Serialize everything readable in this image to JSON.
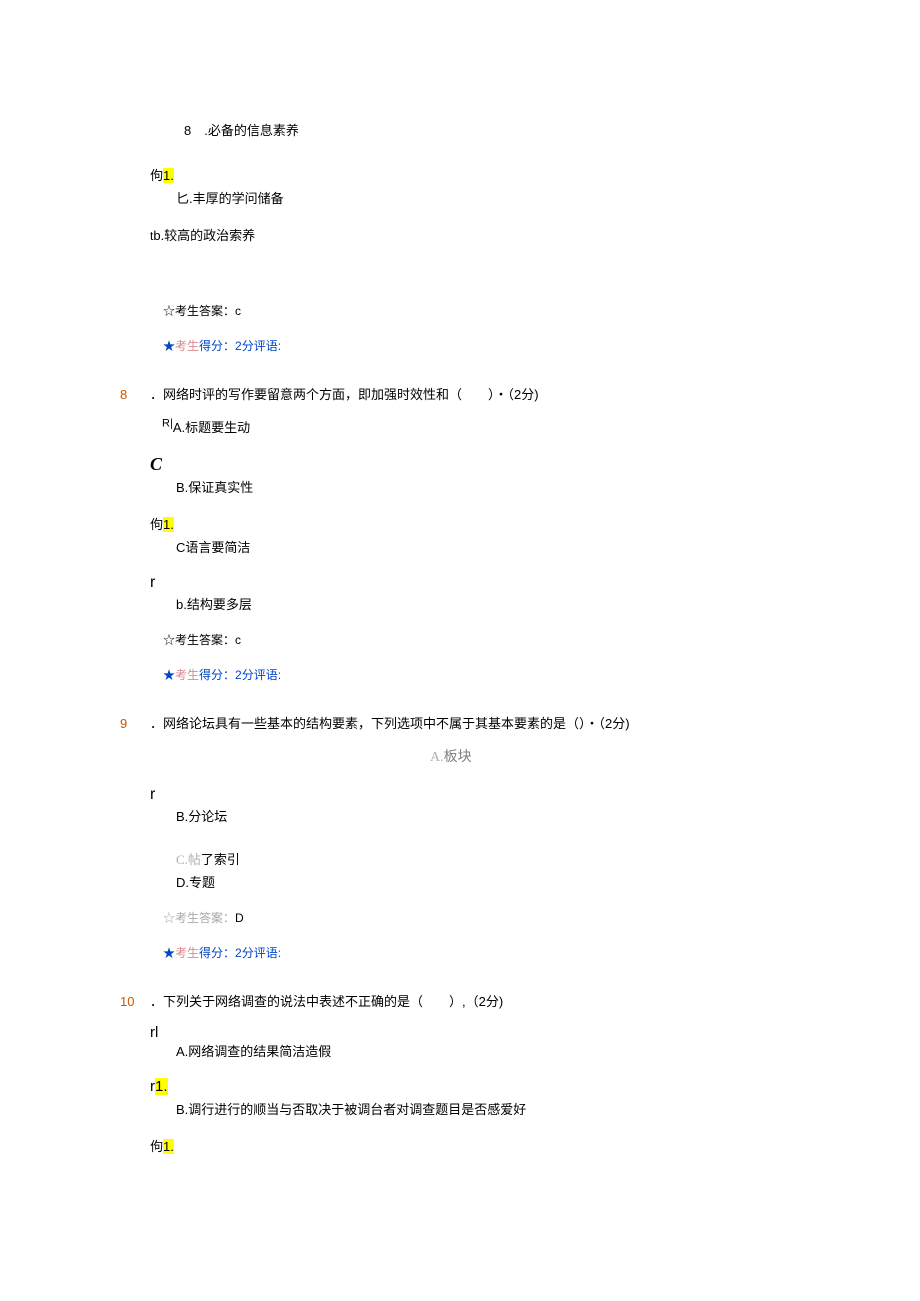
{
  "preamble": {
    "item_b8": "8　.必备的信息素养",
    "marker_gou1": "佝",
    "marker_gou1_hl": "1.",
    "option_b": "匕.丰厚的学问储备",
    "option_tb_prefix": "t",
    "option_tb": "b.较高的政治索养",
    "answer_prefix": "☆考生答案：",
    "answer_value": "c",
    "score_star": "★",
    "score_pink": "考生",
    "score_blue_1": "得分：2分",
    "score_blue_2": "评语:"
  },
  "q8": {
    "number": "8",
    "text": "．网络时评的写作要留意两个方面，即加强时效性和（　　）・（2分)",
    "opt_a_prefix": "R|",
    "opt_a": "A.标题要生动",
    "marker_c": "C",
    "opt_b": "B.保证真实性",
    "marker_gou": "佝",
    "marker_gou_hl": "1.",
    "opt_c": "C语言要简洁",
    "marker_r": "r",
    "opt_d": "b.结构要多层",
    "answer_prefix": "☆考生答案：",
    "answer_value": "c",
    "score_star": "★",
    "score_pink": "考生",
    "score_blue_1": "得分：2分",
    "score_blue_2": "评语:"
  },
  "q9": {
    "number": "9",
    "text": "．网络论坛具有一些基本的结构要素，下列选项中不属于其基本要素的是（）・（2分)",
    "opt_a_faded": "A.",
    "opt_a_text": "板块",
    "marker_r": "r",
    "opt_b": "B.分论坛",
    "opt_c_faded": "C.帖",
    "opt_c_rest": "了索引",
    "opt_d": "D.专题",
    "answer_prefix": "☆考生答案：",
    "answer_value": "D",
    "score_star": "★",
    "score_pink": "考生",
    "score_blue_1": "得分：2分",
    "score_blue_2": "评语:"
  },
  "q10": {
    "number": "10",
    "text": "．下列关于网络调查的说法中表述不正确的是（　　）,（2分)",
    "marker_rl": "rl",
    "opt_a": "A.网络调查的结果简洁造假",
    "marker_r1": "r",
    "marker_r1_hl": "1.",
    "opt_b": "B.调行进行的顺当与否取决于被调台者对调查题目是否感爱好",
    "marker_gou": "佝",
    "marker_gou_hl": "1."
  }
}
